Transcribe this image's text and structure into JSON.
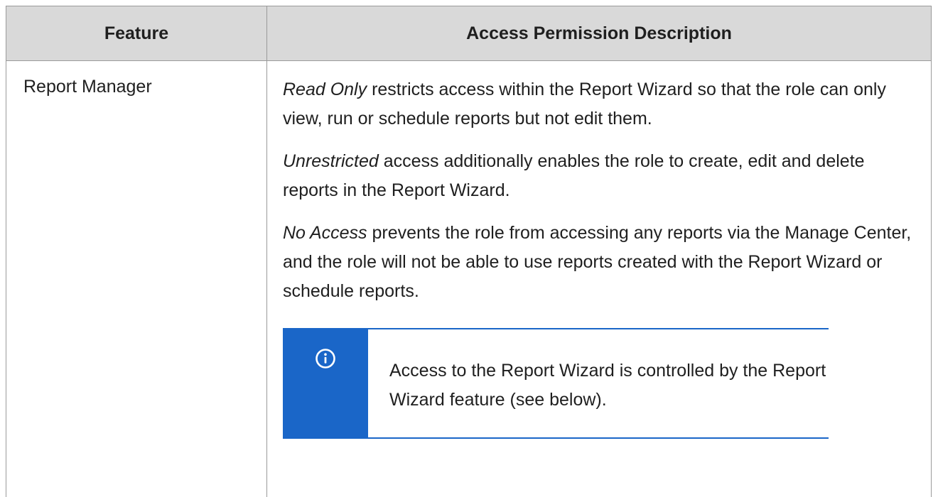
{
  "table": {
    "headers": {
      "feature": "Feature",
      "description": "Access Permission Description"
    },
    "rows": [
      {
        "feature": "Report Manager",
        "paragraphs": [
          {
            "emphasis": "Read Only",
            "text": " restricts access within the Report Wizard so that the role can only view, run or schedule reports but not edit them."
          },
          {
            "emphasis": "Unrestricted",
            "text": " access additionally enables the role to create, edit and delete reports in the Report Wizard."
          },
          {
            "emphasis": "No Access",
            "text": " prevents the role from accessing any reports via the Manage Center, and the role will not be able to use reports created with the Report Wizard or schedule reports."
          }
        ],
        "note": {
          "icon": "info-icon",
          "text": "Access to the Report Wizard is controlled by the Report Wizard feature (see below)."
        }
      }
    ]
  },
  "colors": {
    "header_background": "#d9d9d9",
    "border": "#9a9a9a",
    "note_accent": "#1a66c8"
  }
}
